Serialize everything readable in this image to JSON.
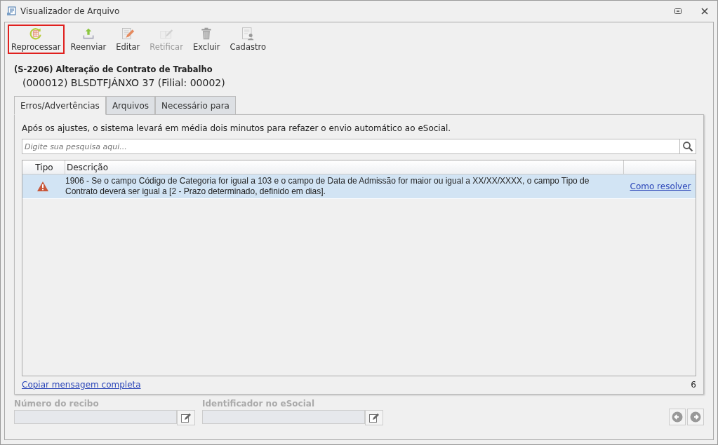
{
  "window": {
    "title": "Visualizador de Arquivo"
  },
  "toolbar": [
    {
      "label": "Reprocessar",
      "kind": "reprocess",
      "selected": true,
      "disabled": false
    },
    {
      "label": "Reenviar",
      "kind": "upload",
      "selected": false,
      "disabled": false
    },
    {
      "label": "Editar",
      "kind": "edit",
      "selected": false,
      "disabled": false
    },
    {
      "label": "Retificar",
      "kind": "rectify",
      "selected": false,
      "disabled": true
    },
    {
      "label": "Excluir",
      "kind": "delete",
      "selected": false,
      "disabled": false
    },
    {
      "label": "Cadastro",
      "kind": "register",
      "selected": false,
      "disabled": false
    }
  ],
  "event": {
    "title": "(S-2206) Alteração de Contrato de Trabalho",
    "subtitle": "(000012) BLSDTFJÁNXO 37 (Filial: 00002)"
  },
  "tabs": [
    {
      "label": "Erros/Advertências",
      "selected": true
    },
    {
      "label": "Arquivos",
      "selected": false
    },
    {
      "label": "Necessário para",
      "selected": false
    }
  ],
  "notice": "Após os ajustes, o sistema levará em média dois minutos para refazer o envio automático ao eSocial.",
  "search": {
    "placeholder": "Digite sua pesquisa aqui..."
  },
  "table": {
    "columns": [
      "Tipo",
      "Descrição"
    ],
    "rows": [
      {
        "kind": "warning",
        "selected": true,
        "description": "1906 - Se o campo Código de Categoria for igual a 103 e o campo de Data de Admissão for maior ou igual a XX/XX/XXXX, o campo Tipo de Contrato deverá ser igual a [2 - Prazo determinado, definido em dias].",
        "link": "Como resolver"
      }
    ]
  },
  "footer": {
    "copy_link": "Copiar mensagem completa",
    "count": "6"
  },
  "fields": [
    {
      "label": "Número do recibo",
      "disabled": true
    },
    {
      "label": "Identificador no eSocial",
      "disabled": true
    }
  ]
}
